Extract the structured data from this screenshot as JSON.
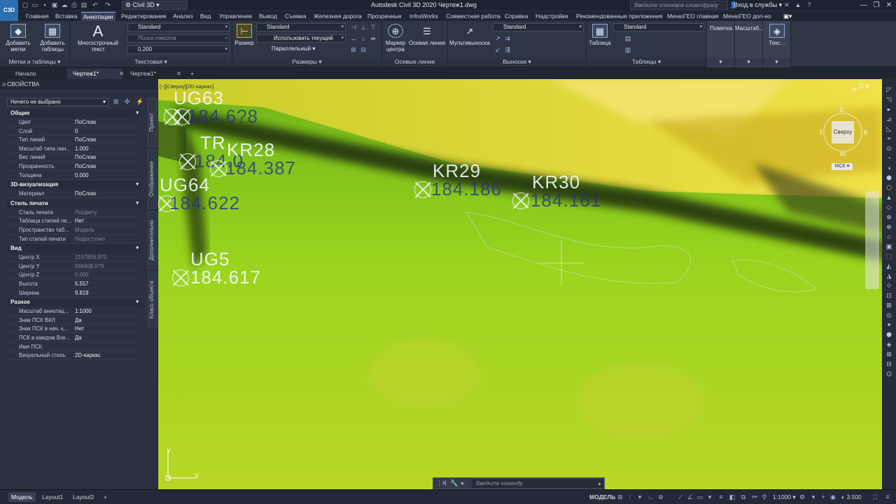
{
  "app": {
    "logo_text": "C3D",
    "title": "Autodesk Civil 3D 2020   Чертеж1.dwg",
    "workspace": "Civil 3D",
    "search_placeholder": "Введите ключевое слово/фразу",
    "signin": "Вход в службы"
  },
  "menu_tabs": [
    "Главная",
    "Вставка",
    "Аннотации",
    "Редактирование",
    "Анализ",
    "Вид",
    "Управление",
    "Вывод",
    "Съемка",
    "Железная дорога",
    "Прозрачные",
    "InfraWorks",
    "Совместная работа",
    "Справка",
    "Надстройки",
    "Рекомендованные приложения",
    "МенюГЕО главная",
    "МенюГЕО доп-но"
  ],
  "active_tab": "Аннотации",
  "ribbon": {
    "labels_panel": {
      "title": "Метки и таблицы",
      "add_labels": "Добавить метки",
      "add_tables": "Добавить таблицы"
    },
    "text_panel": {
      "title": "Текстовая",
      "mtext": "Многострочный текст",
      "style": "Standard",
      "search_placeholder": "Поиск текста",
      "height": "0.200"
    },
    "dims_panel": {
      "title": "Размеры",
      "dim": "Размер",
      "style": "Standard",
      "layer": "Использовать текущий",
      "parallel": "Параллельный"
    },
    "centerlines_panel": {
      "title": "Осевые линии",
      "center_mark": "Маркер центра",
      "centerline": "Осевая линия"
    },
    "leaders_panel": {
      "title": "Выноски",
      "mleader": "Мультивыноска",
      "style": "Standard"
    },
    "tables_panel": {
      "title": "Таблицы",
      "table": "Таблица",
      "style": "Standard"
    },
    "markup_panel": {
      "title": "Пометка"
    },
    "scale_panel": {
      "title": "Масштаб..."
    },
    "text2_panel": {
      "title": "Текс..."
    }
  },
  "doc_tabs": [
    "Начало",
    "Чертеж1*",
    "Чертеж1*"
  ],
  "properties": {
    "header": "СВОЙСТВА",
    "selection": "Ничего не выбрано",
    "sections": [
      {
        "name": "Общие",
        "rows": [
          {
            "k": "Цвет",
            "v": "ПоСлою"
          },
          {
            "k": "Слой",
            "v": "0"
          },
          {
            "k": "Тип линий",
            "v": "ПоСлою"
          },
          {
            "k": "Масштаб типа лин...",
            "v": "1.000"
          },
          {
            "k": "Вес линий",
            "v": "ПоСлою"
          },
          {
            "k": "Прозрачность",
            "v": "ПоСлою"
          },
          {
            "k": "Толщина",
            "v": "0.000"
          }
        ]
      },
      {
        "name": "3D-визуализация",
        "rows": [
          {
            "k": "Материал",
            "v": "ПоСлою"
          }
        ]
      },
      {
        "name": "Стиль печати",
        "rows": [
          {
            "k": "Стиль печати",
            "v": "ПоЦвету"
          },
          {
            "k": "Таблица стилей пе...",
            "v": "Нет"
          },
          {
            "k": "Пространство таб...",
            "v": "Модель"
          },
          {
            "k": "Тип стилей печати",
            "v": "Недоступно"
          }
        ]
      },
      {
        "name": "Вид",
        "rows": [
          {
            "k": "Центр X",
            "v": "2197856.970"
          },
          {
            "k": "Центр Y",
            "v": "568408.078"
          },
          {
            "k": "Центр Z",
            "v": "0.000"
          },
          {
            "k": "Высота",
            "v": "5.557"
          },
          {
            "k": "Ширина",
            "v": "9.819"
          }
        ]
      },
      {
        "name": "Разное",
        "rows": [
          {
            "k": "Масштаб аннотац...",
            "v": "1:1000"
          },
          {
            "k": "Знак ПСК ВКЛ",
            "v": "Да"
          },
          {
            "k": "Знак ПСК в нач. к...",
            "v": "Нет"
          },
          {
            "k": "ПСК в каждом Вэк...",
            "v": "Да"
          },
          {
            "k": "Имя ПСК",
            "v": ""
          },
          {
            "k": "Визуальный стиль",
            "v": "2D-каркас"
          }
        ]
      }
    ],
    "side_tabs": [
      "Проект",
      "Отображение",
      "Дополнительно",
      "Класс объекта"
    ]
  },
  "viewport": {
    "label": "[−][Сверху][2D-каркас]",
    "viewcube_top": "Сверху",
    "viewcube_n": "С",
    "viewcube_s": "Ю",
    "viewcube_w": "З",
    "viewcube_e": "В",
    "ucs": "МСК",
    "points": [
      {
        "name": "UG63",
        "elev": "184.6?8"
      },
      {
        "name": "TR",
        "elev": "184.0"
      },
      {
        "name": "KR28",
        "elev": "184.387"
      },
      {
        "name": "UG64",
        "elev": "184.622"
      },
      {
        "name": "KR29",
        "elev": "184.186"
      },
      {
        "name": "KR30",
        "elev": "184.161"
      },
      {
        "name": "UG5",
        "elev": "184.617"
      }
    ]
  },
  "command_placeholder": "Введите команду",
  "status": {
    "tabs": [
      "Модель",
      "Layout1",
      "Layout2"
    ],
    "model": "МОДЕЛЬ",
    "scale": "1:1000",
    "value": "3.500"
  }
}
